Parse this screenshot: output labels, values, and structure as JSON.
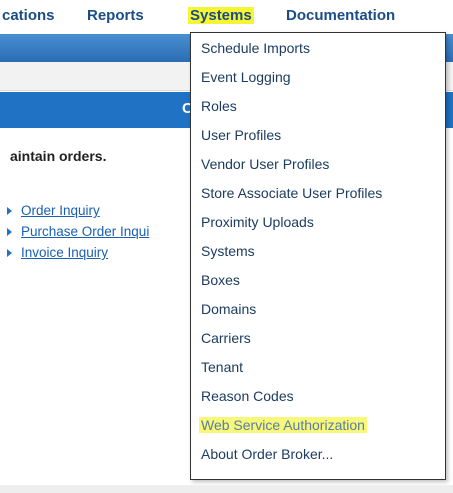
{
  "topnav": {
    "items": [
      {
        "label": "cations"
      },
      {
        "label": "Reports"
      },
      {
        "label": "Systems"
      },
      {
        "label": "Documentation"
      }
    ]
  },
  "header": {
    "text": "C"
  },
  "main": {
    "intro": "aintain orders.",
    "links": [
      {
        "label": "Order Inquiry"
      },
      {
        "label": "Purchase Order Inqui"
      },
      {
        "label": "Invoice Inquiry"
      }
    ]
  },
  "dropdown": {
    "items": [
      {
        "label": "Schedule Imports"
      },
      {
        "label": "Event Logging"
      },
      {
        "label": "Roles"
      },
      {
        "label": "User Profiles"
      },
      {
        "label": "Vendor User Profiles"
      },
      {
        "label": "Store Associate User Profiles"
      },
      {
        "label": "Proximity Uploads"
      },
      {
        "label": "Systems"
      },
      {
        "label": "Boxes"
      },
      {
        "label": "Domains"
      },
      {
        "label": "Carriers"
      },
      {
        "label": "Tenant"
      },
      {
        "label": "Reason Codes"
      },
      {
        "label": "Web Service Authorization"
      },
      {
        "label": "About Order Broker..."
      }
    ]
  },
  "colors": {
    "nav_text": "#1a4d86",
    "active_highlight": "#f5f533",
    "header_blue": "#1f72c4",
    "link_blue": "#1a5fb4"
  }
}
